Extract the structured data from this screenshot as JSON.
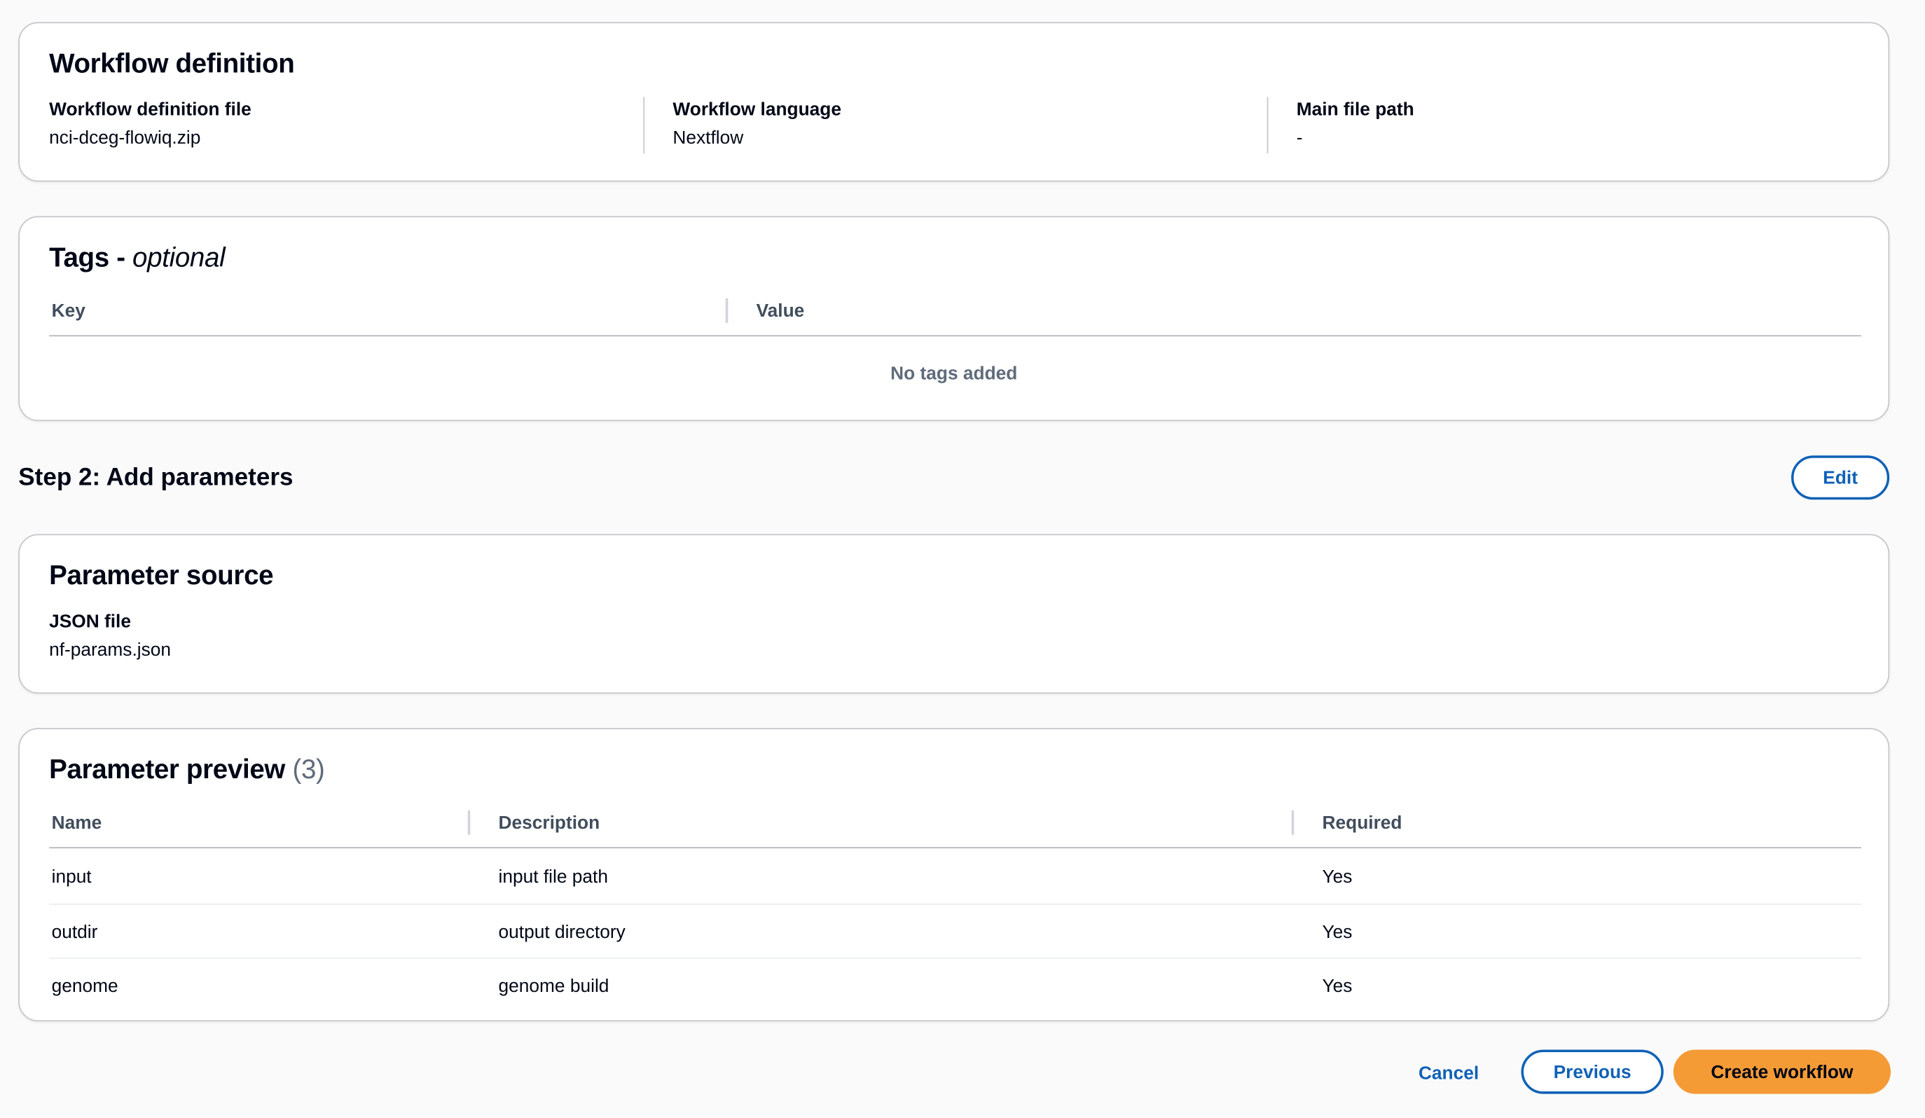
{
  "workflow_definition": {
    "title": "Workflow definition",
    "fields": [
      {
        "label": "Workflow definition file",
        "value": "nci-dceg-flowiq.zip"
      },
      {
        "label": "Workflow language",
        "value": "Nextflow"
      },
      {
        "label": "Main file path",
        "value": "-"
      }
    ]
  },
  "tags": {
    "title": "Tags",
    "title_suffix": "optional",
    "separator": " - ",
    "columns": [
      "Key",
      "Value"
    ],
    "empty_message": "No tags added"
  },
  "step2": {
    "heading": "Step 2: Add parameters",
    "edit_label": "Edit"
  },
  "parameter_source": {
    "title": "Parameter source",
    "label": "JSON file",
    "value": "nf-params.json"
  },
  "parameter_preview": {
    "title": "Parameter preview",
    "count": "(3)",
    "columns": [
      "Name",
      "Description",
      "Required"
    ],
    "rows": [
      {
        "name": "input",
        "description": "input file path",
        "required": "Yes"
      },
      {
        "name": "outdir",
        "description": "output directory",
        "required": "Yes"
      },
      {
        "name": "genome",
        "description": "genome build",
        "required": "Yes"
      }
    ]
  },
  "footer": {
    "cancel_label": "Cancel",
    "previous_label": "Previous",
    "create_label": "Create workflow"
  },
  "colors": {
    "primary_button": "#f49b36",
    "link_blue": "#0f61b7",
    "border": "#c6c6cd"
  }
}
